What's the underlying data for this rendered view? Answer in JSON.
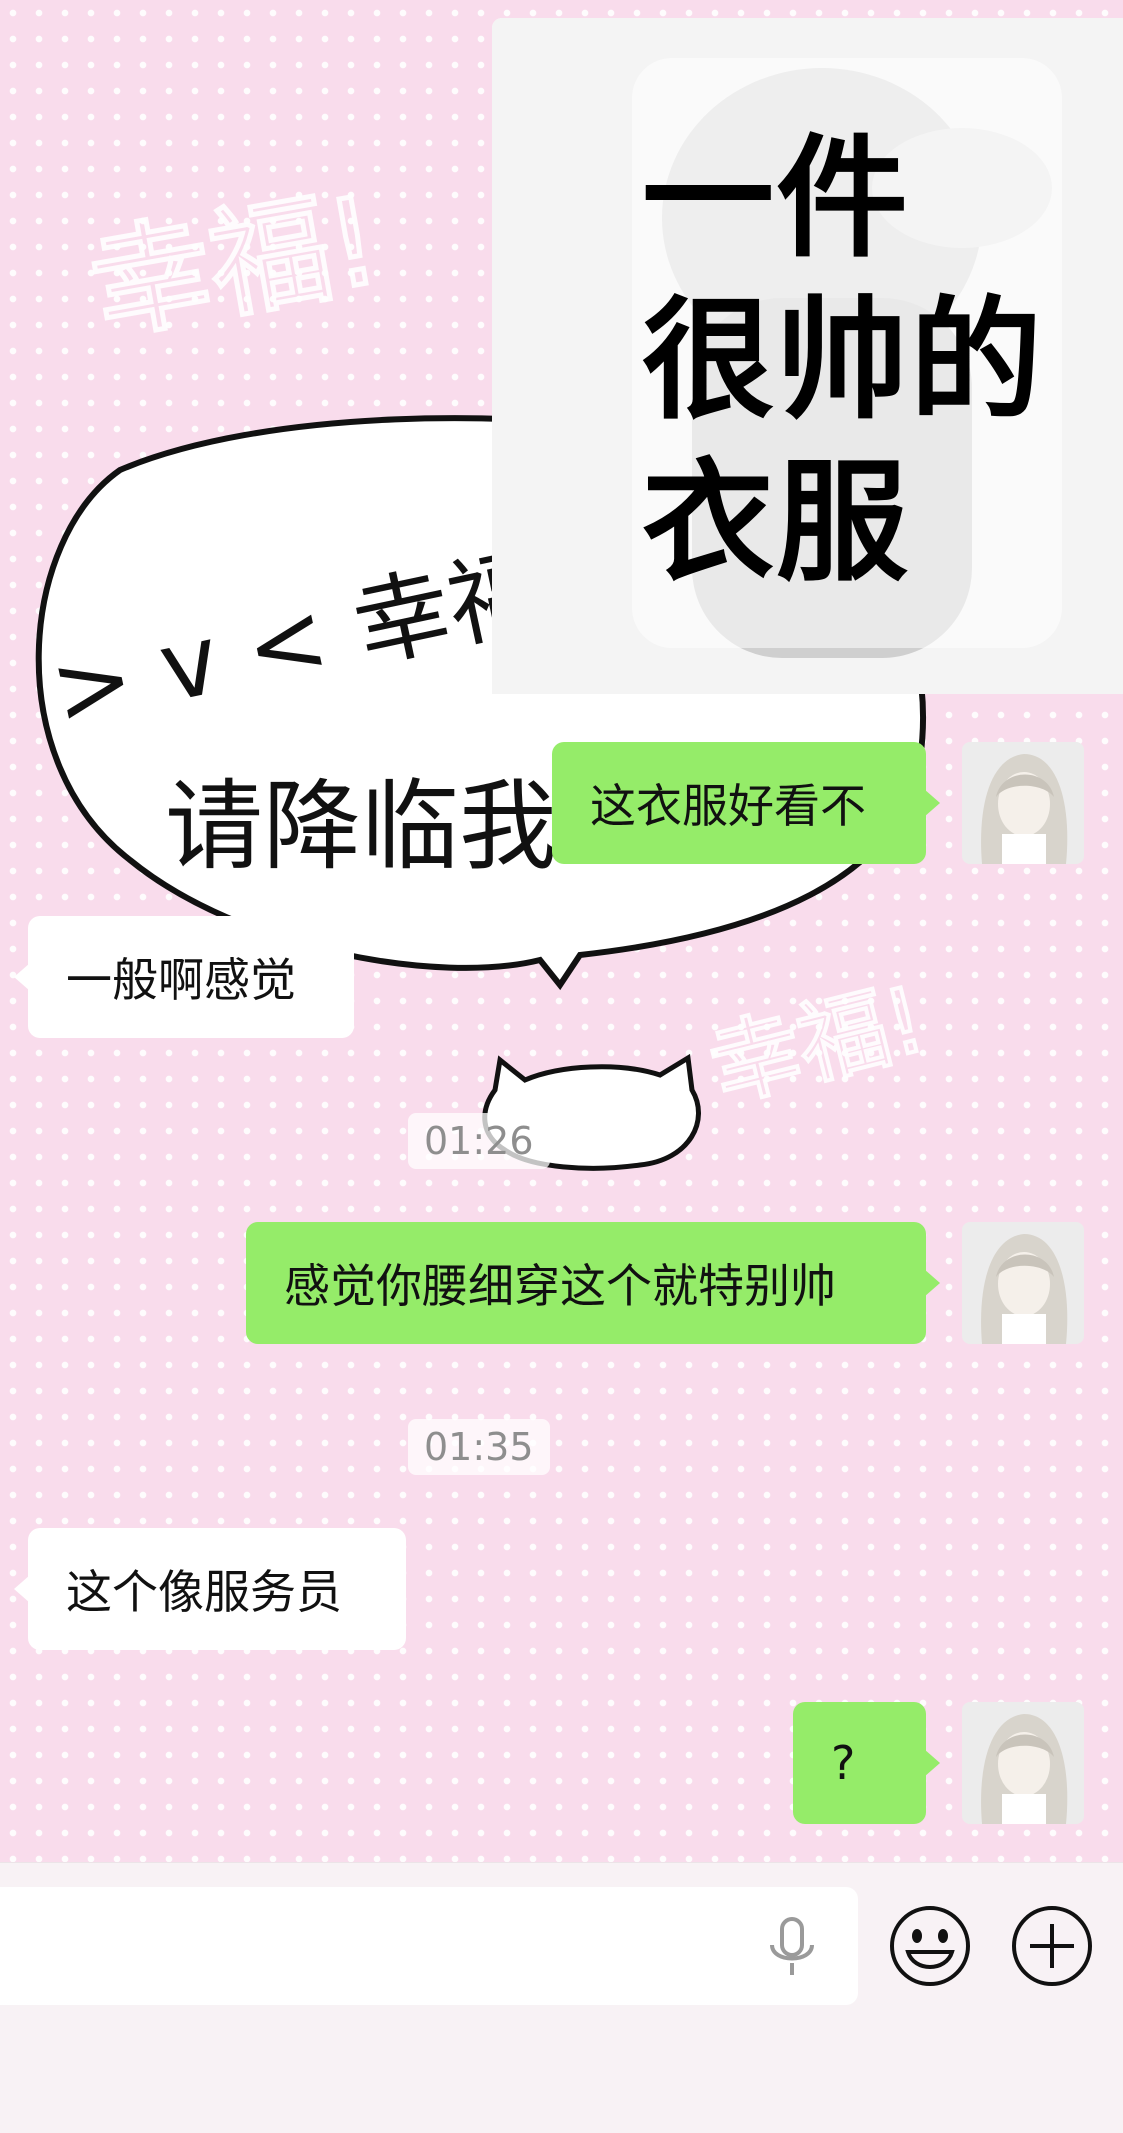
{
  "sticker": {
    "lines": [
      "一件",
      "很帅的",
      "衣服"
    ]
  },
  "background_art": {
    "bubble_text_1": "> v < 幸福",
    "bubble_text_2": "请降临我",
    "top_text": "幸福!",
    "right_text": "幸福!"
  },
  "messages": [
    {
      "side": "out",
      "text": "这衣服好看不"
    },
    {
      "side": "in",
      "text": "一般啊感觉"
    },
    {
      "type": "time",
      "text": "01:26"
    },
    {
      "side": "out",
      "text": "感觉你腰细穿这个就特别帅"
    },
    {
      "type": "time",
      "text": "01:35"
    },
    {
      "side": "in",
      "text": "这个像服务员"
    },
    {
      "side": "out",
      "text": "?"
    }
  ],
  "input": {
    "value": "",
    "placeholder": ""
  },
  "icons": {
    "voice": "microphone-icon",
    "emoji": "smiley-icon",
    "more": "plus-circle-icon"
  },
  "colors": {
    "outgoing_bubble": "#95ec69",
    "incoming_bubble": "#ffffff",
    "chat_background": "#f9dcec"
  }
}
